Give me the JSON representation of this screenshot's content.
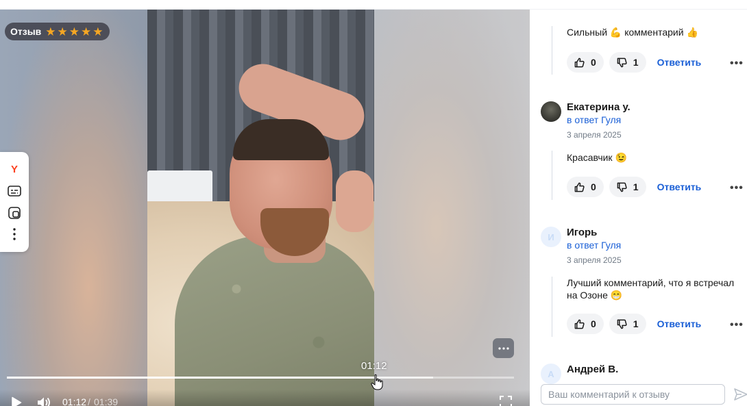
{
  "video": {
    "review_label": "Отзыв",
    "rating": 5,
    "star_count": 5,
    "hover_time": "01:12",
    "current_time": "01:12",
    "separator": "/",
    "total_time": "01:39",
    "progress": 0.727,
    "buffered": 0.84
  },
  "side_tools": {
    "items": [
      "yandex-icon",
      "subtitles-icon",
      "pip-icon",
      "more-vertical-icon"
    ],
    "yandex_letter": "Y"
  },
  "comments": {
    "first": {
      "text": "Сильный",
      "emoji1": "💪",
      "text2": "комментарий",
      "emoji2": "👍",
      "likes": "0",
      "dislikes": "1",
      "reply_label": "Ответить",
      "more": "•••"
    },
    "items": [
      {
        "author": "Екатерина у.",
        "reply_to": "в ответ Гуля",
        "date": "3 апреля 2025",
        "text": "Красавчик",
        "emoji": "😉",
        "likes": "0",
        "dislikes": "1",
        "reply_label": "Ответить",
        "more": "•••"
      },
      {
        "author": "Игорь",
        "avatar_letter": "И",
        "reply_to": "в ответ Гуля",
        "date": "3 апреля 2025",
        "text": "Лучший комментарий, что я встречал на Озоне",
        "emoji": "😁",
        "likes": "0",
        "dislikes": "1",
        "reply_label": "Ответить",
        "more": "•••"
      },
      {
        "author": "Андрей В.",
        "avatar_letter": "А"
      }
    ],
    "input_placeholder": "Ваш комментарий к отзыву"
  },
  "colors": {
    "link": "#1a5fd6",
    "star": "#f5a623",
    "yandex": "#fc3f1d"
  }
}
